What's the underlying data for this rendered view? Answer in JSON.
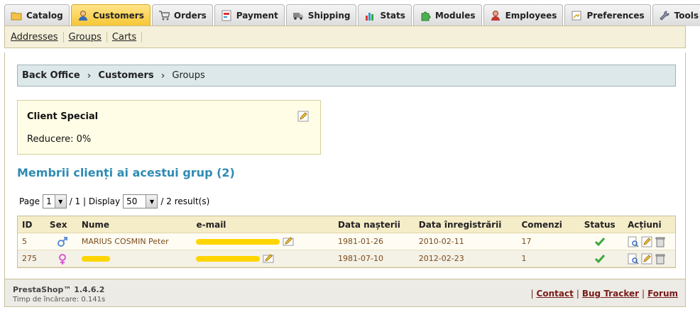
{
  "tabs": [
    {
      "label": "Catalog",
      "icon": "folder-icon"
    },
    {
      "label": "Customers",
      "icon": "user-icon"
    },
    {
      "label": "Orders",
      "icon": "cart-icon"
    },
    {
      "label": "Payment",
      "icon": "payment-icon"
    },
    {
      "label": "Shipping",
      "icon": "truck-icon"
    },
    {
      "label": "Stats",
      "icon": "chart-icon"
    },
    {
      "label": "Modules",
      "icon": "puzzle-icon"
    },
    {
      "label": "Employees",
      "icon": "employee-icon"
    },
    {
      "label": "Preferences",
      "icon": "preferences-icon"
    },
    {
      "label": "Tools",
      "icon": "wrench-icon"
    }
  ],
  "active_tab": "Customers",
  "submenu": [
    "Addresses",
    "Groups",
    "Carts"
  ],
  "breadcrumb": {
    "root": "Back Office",
    "section": "Customers",
    "current": "Groups"
  },
  "group": {
    "name": "Client Special",
    "discount": "Reducere: 0%"
  },
  "members_title": "Membrii clienți ai acestui grup (2)",
  "pager": {
    "page_label": "Page",
    "page_value": "1",
    "of_pages": "/ 1 | Display",
    "display_value": "50",
    "result": "/ 2 result(s)"
  },
  "table": {
    "headers": {
      "id": "ID",
      "sex": "Sex",
      "name": "Nume",
      "email": "e-mail",
      "birth": "Data nașterii",
      "reg": "Data înregistrării",
      "orders": "Comenzi",
      "status": "Status",
      "actions": "Acțiuni"
    },
    "rows": [
      {
        "id": "5",
        "sex": "male",
        "name": "MARIUS COSMIN Peter",
        "birth": "1981-01-26",
        "reg": "2010-02-11",
        "orders": "17"
      },
      {
        "id": "275",
        "sex": "female",
        "name": "",
        "birth": "1981-07-10",
        "reg": "2012-02-23",
        "orders": "1"
      }
    ]
  },
  "footer": {
    "version": "PrestaShop™ 1.4.6.2",
    "load_time": "Timp de încărcare: 0.141s",
    "links": [
      "Contact",
      "Bug Tracker",
      "Forum"
    ]
  },
  "colors": {
    "active_tab": "#f6c630",
    "title_blue": "#2f8bb3",
    "breadcrumb_bg": "#dde8ea",
    "group_box_bg": "#fffde6",
    "link_red": "#7a1a1a",
    "redaction": "#ffd500"
  }
}
